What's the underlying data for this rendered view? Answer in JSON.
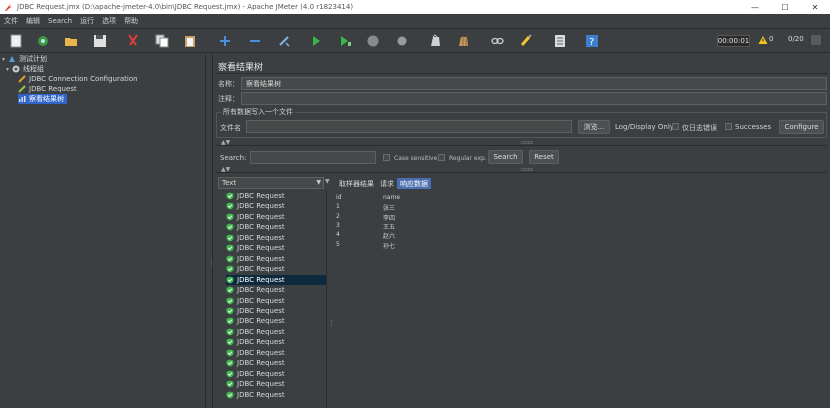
{
  "window": {
    "title": "JDBC Request.jmx (D:\\apache-jmeter-4.0\\bin\\JDBC Request.jmx) - Apache JMeter (4.0 r1823414)",
    "controls": {
      "minimize": "—",
      "maximize": "☐",
      "close": "✕"
    }
  },
  "menu": [
    "文件",
    "编辑",
    "Search",
    "运行",
    "选项",
    "帮助"
  ],
  "toolbar": {
    "timer": "00:00:01",
    "warnings": "0",
    "threads": "0/20",
    "icons": [
      "new-icon",
      "templates-icon",
      "open-icon",
      "save-icon",
      "cut-icon",
      "copy-icon",
      "paste-icon",
      "expand-icon",
      "collapse-icon",
      "toggle-icon",
      "start-icon",
      "start-no-pause-icon",
      "stop-icon",
      "shutdown-icon",
      "clear-icon",
      "clear-all-icon",
      "search-icon",
      "reset-search-icon",
      "function-helper-icon",
      "help-icon"
    ]
  },
  "tree": {
    "items": [
      {
        "label": "测试计划",
        "icon": "test-plan-icon",
        "level": 0
      },
      {
        "label": "线程组",
        "icon": "thread-group-icon",
        "level": 1
      },
      {
        "label": "JDBC Connection Configuration",
        "icon": "config-icon",
        "level": 2
      },
      {
        "label": "JDBC Request",
        "icon": "sampler-icon",
        "level": 2
      },
      {
        "label": "察看结果树",
        "icon": "listener-icon",
        "level": 2,
        "selected": true
      }
    ]
  },
  "panel": {
    "title": "察看结果树",
    "name_label": "名称：",
    "name_value": "察看结果树",
    "comment_label": "注释：",
    "file_group_title": "所有数据写入一个文件",
    "filename_label": "文件名",
    "browse_button": "浏览...",
    "log_display_label": "Log/Display Only:",
    "errors_label": "仅日志错误",
    "successes_label": "Successes",
    "configure_button": "Configure",
    "search_label": "Search:",
    "case_sensitive_label": "Case sensitive",
    "regex_label": "Regular exp.",
    "search_button": "Search",
    "reset_button": "Reset",
    "renderer": "Text",
    "tabs": [
      "取样器结果",
      "请求",
      "响应数据"
    ],
    "active_tab": 2
  },
  "samples": {
    "label": "JDBC Request",
    "count": 20,
    "selected_index": 8
  },
  "response": {
    "columns": [
      "id",
      "name"
    ],
    "rows": [
      [
        "1",
        "张三"
      ],
      [
        "2",
        "李四"
      ],
      [
        "3",
        "王五"
      ],
      [
        "4",
        "赵六"
      ],
      [
        "5",
        "孙七"
      ]
    ]
  }
}
